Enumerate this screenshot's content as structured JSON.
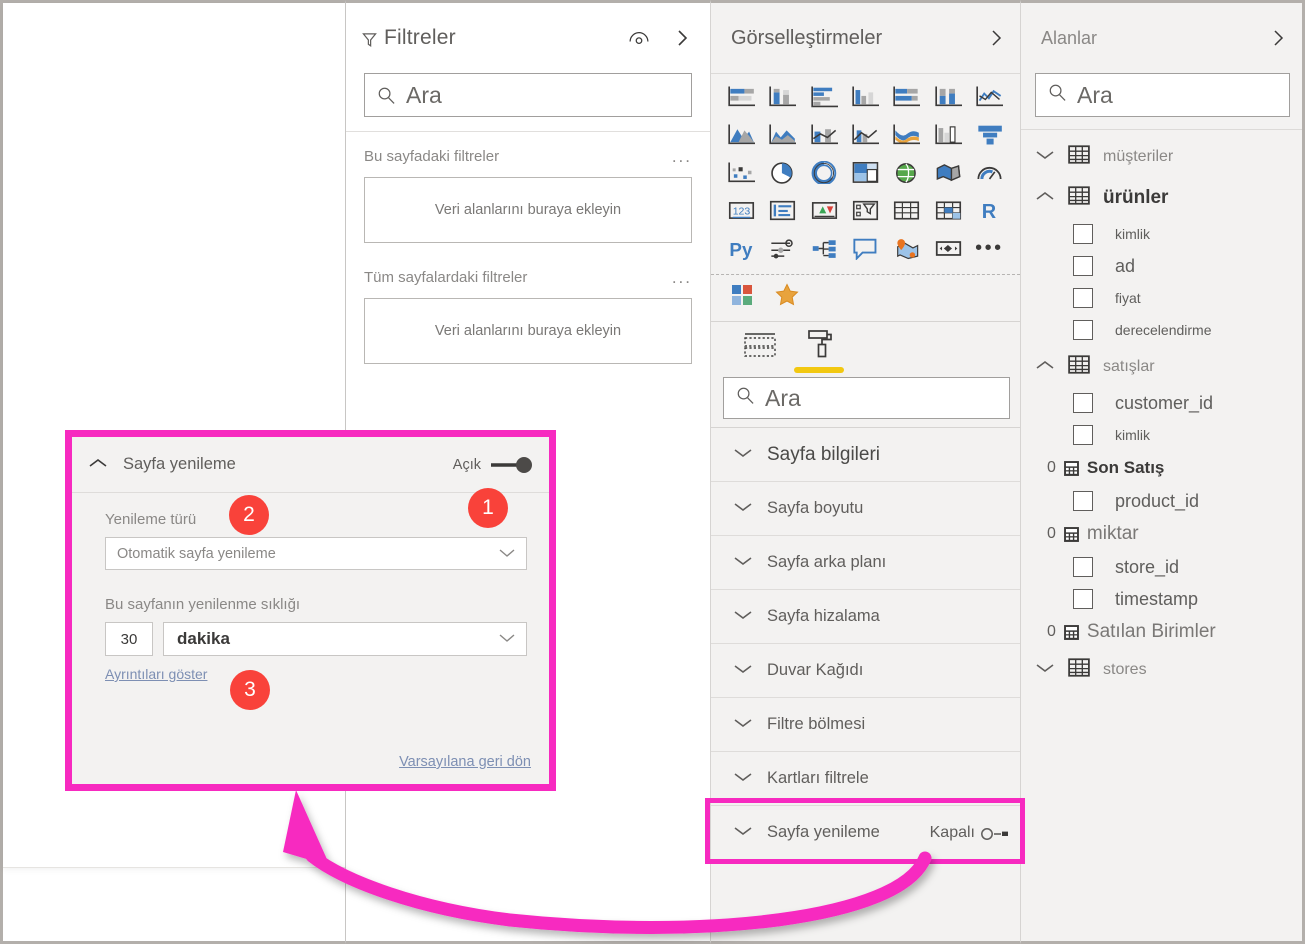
{
  "filter_pane": {
    "title": "Filtreler",
    "funnel_icon": "filter-funnel-icon",
    "eye_icon": "eye-icon",
    "expand_icon": "chevron-right-icon",
    "search_placeholder": "Ara",
    "search_icon": "search-icon",
    "sections": [
      {
        "title": "Bu sayfadaki filtreler",
        "dropzone": "Veri alanlarını buraya ekleyin",
        "more": "..."
      },
      {
        "title": "Tüm sayfalardaki filtreler",
        "dropzone": "Veri alanlarını buraya ekleyin",
        "more": "..."
      }
    ]
  },
  "viz_pane": {
    "title": "Görselleştirmeler",
    "expand_icon": "chevron-right-icon",
    "icons": [
      "stacked-bar-chart-icon",
      "stacked-column-chart-icon",
      "clustered-bar-chart-icon",
      "clustered-column-chart-icon",
      "100-stacked-bar-chart-icon",
      "100-stacked-column-chart-icon",
      "line-chart-icon",
      "area-chart-icon",
      "stacked-area-chart-icon",
      "line-stacked-column-chart-icon",
      "line-clustered-column-chart-icon",
      "ribbon-chart-icon",
      "waterfall-chart-icon",
      "funnel-chart-icon",
      "scatter-chart-icon",
      "pie-chart-icon",
      "donut-chart-icon",
      "treemap-icon",
      "map-icon",
      "filled-map-icon",
      "gauge-icon",
      "card-icon",
      "multi-row-card-icon",
      "kpi-icon",
      "slicer-icon",
      "table-icon",
      "matrix-icon",
      "r-script-visual-icon",
      "python-visual-icon",
      "key-influencers-icon",
      "decomposition-tree-icon",
      "qa-visual-icon",
      "arcgis-map-icon",
      "paginated-report-icon",
      "more-visuals-icon"
    ],
    "extra_icons": [
      "get-more-visuals-icon",
      "favorite-visuals-icon"
    ],
    "tabs": [
      {
        "name": "fields-tab",
        "icon": "fields-table-icon",
        "active": false
      },
      {
        "name": "format-tab",
        "icon": "paint-roller-icon",
        "active": true
      }
    ],
    "search_placeholder": "Ara",
    "search_icon": "search-icon",
    "format_sections": [
      {
        "label": "Sayfa bilgileri",
        "state": ""
      },
      {
        "label": "Sayfa boyutu",
        "state": ""
      },
      {
        "label": "Sayfa arka planı",
        "state": ""
      },
      {
        "label": "Sayfa hizalama",
        "state": ""
      },
      {
        "label": "Duvar Kağıdı",
        "state": ""
      },
      {
        "label": "Filtre bölmesi",
        "state": ""
      },
      {
        "label": "Kartları filtrele",
        "state": ""
      },
      {
        "label": "Sayfa yenileme",
        "state": "Kapalı"
      }
    ]
  },
  "fields_pane": {
    "title": "Alanlar",
    "expand_icon": "chevron-right-icon",
    "search_placeholder": "Ara",
    "search_icon": "search-icon",
    "tree": [
      {
        "type": "table",
        "label": "müşteriler",
        "expanded": false,
        "bold": false
      },
      {
        "type": "table",
        "label": "ürünler",
        "expanded": true,
        "bold": true
      },
      {
        "type": "field",
        "label": "kimlik"
      },
      {
        "type": "field",
        "label": "ad"
      },
      {
        "type": "field",
        "label": "fiyat"
      },
      {
        "type": "field",
        "label": "derecelendirme"
      },
      {
        "type": "table",
        "label": "satışlar",
        "expanded": true,
        "bold": false
      },
      {
        "type": "field",
        "label": "customer_id"
      },
      {
        "type": "field",
        "label": "kimlik"
      },
      {
        "type": "measure",
        "label": "Son Satış"
      },
      {
        "type": "field",
        "label": "product_id"
      },
      {
        "type": "measure",
        "label": "miktar"
      },
      {
        "type": "field",
        "label": "store_id"
      },
      {
        "type": "field",
        "label": "timestamp"
      },
      {
        "type": "measure",
        "label": "Satılan Birimler"
      },
      {
        "type": "table",
        "label": "stores",
        "expanded": false,
        "bold": false
      }
    ]
  },
  "refresh_card": {
    "collapse_icon": "chevron-up-icon",
    "title": "Sayfa yenileme",
    "toggle_label": "Açık",
    "toggle_on": true,
    "refresh_type_label": "Yenileme türü",
    "refresh_type_value": "Otomatik sayfa yenileme",
    "refresh_type_chevron": "chevron-down-icon",
    "frequency_label": "Bu sayfanın yenilenme sıklığı",
    "frequency_value": "30",
    "frequency_unit": "dakika",
    "frequency_chevron": "chevron-down-icon",
    "details_link": "Ayrıntıları göster",
    "reset_link": "Varsayılana geri dön"
  },
  "callouts": [
    {
      "number": "1",
      "target": "toggle"
    },
    {
      "number": "2",
      "target": "refresh-type"
    },
    {
      "number": "3",
      "target": "details-link"
    }
  ],
  "annotation": {
    "highlight_color": "#f72ac0",
    "badge_color": "#f9423a",
    "arrow_icon": "curved-arrow-icon"
  }
}
